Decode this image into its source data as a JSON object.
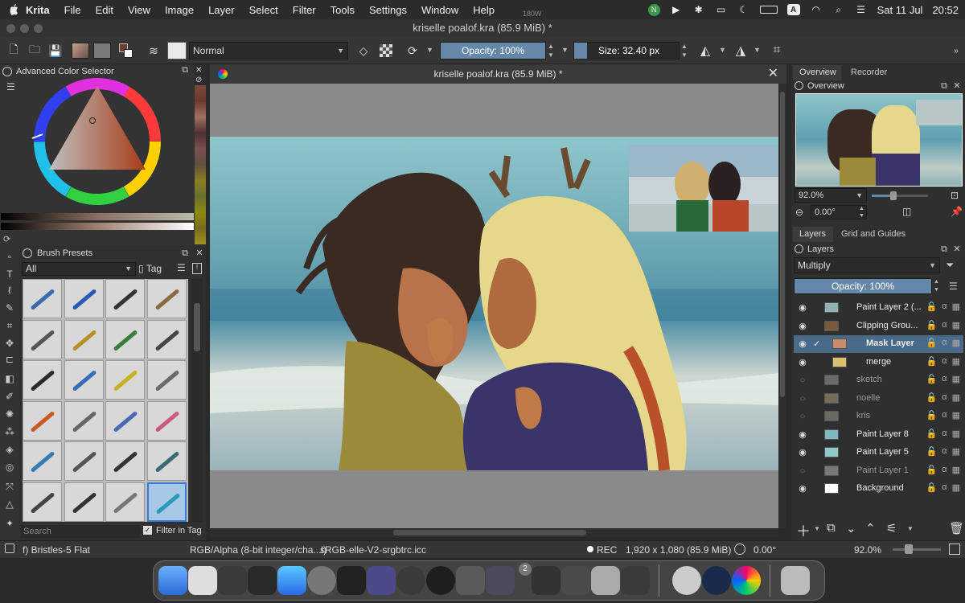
{
  "menubar": {
    "app": "Krita",
    "items": [
      "File",
      "Edit",
      "View",
      "Image",
      "Layer",
      "Select",
      "Filter",
      "Tools",
      "Settings",
      "Window",
      "Help"
    ],
    "center_badge": "180W",
    "date": "Sat 11 Jul",
    "time": "20:52",
    "input_indicator": "A"
  },
  "window": {
    "title": "kriselle poalof.kra (85.9 MiB) *"
  },
  "toolbar": {
    "blend_mode": "Normal",
    "opacity": "Opacity: 100%",
    "opacity_value": 1.0,
    "size": "Size: 32.40 px",
    "size_fill": 0.12
  },
  "color_selector": {
    "title": "Advanced Color Selector"
  },
  "brush_presets": {
    "title": "Brush Presets",
    "filter": "All",
    "tag": "Tag",
    "search_placeholder": "Search",
    "filter_in_tag": "Filter in Tag"
  },
  "document": {
    "tab_title": "kriselle poalof.kra (85.9 MiB) *"
  },
  "overview": {
    "tabs": [
      "Overview",
      "Recorder"
    ],
    "title": "Overview",
    "zoom": "92.0%",
    "rotation": "0.00°"
  },
  "layers": {
    "tabs": [
      "Layers",
      "Grid and Guides"
    ],
    "title": "Layers",
    "blend_mode": "Multiply",
    "opacity": "Opacity:  100%",
    "items": [
      {
        "name": "Paint Layer 2 (...",
        "visible": true,
        "thumb": "#8fb4b8"
      },
      {
        "name": "Clipping Grou...",
        "visible": true,
        "thumb": "#7a5a3a"
      },
      {
        "name": "Mask Layer",
        "visible": true,
        "thumb": "#c88a6a",
        "selected": true,
        "check": "✓"
      },
      {
        "name": "merge",
        "visible": true,
        "thumb": "#d8c070"
      },
      {
        "name": "sketch",
        "visible": false,
        "thumb": "#6a6a6a"
      },
      {
        "name": "noelle",
        "visible": false,
        "thumb": "#7a6a5a"
      },
      {
        "name": "kris",
        "visible": false,
        "thumb": "#6a6a60"
      },
      {
        "name": "Paint Layer 8",
        "visible": true,
        "thumb": "#7fb8c0"
      },
      {
        "name": "Paint Layer 5",
        "visible": true,
        "thumb": "#8fc8c8"
      },
      {
        "name": "Paint Layer 1",
        "visible": false,
        "thumb": "#777"
      },
      {
        "name": "Background",
        "visible": true,
        "thumb": "#ffffff"
      }
    ]
  },
  "status": {
    "brush": "f) Bristles-5 Flat",
    "colorspace": "RGB/Alpha (8-bit integer/cha...l)",
    "profile": "sRGB-elle-V2-srgbtrc.icc",
    "rec": "REC",
    "dims": "1,920 x 1,080 (85.9 MiB)",
    "rotation": "0.00°",
    "zoom": "92.0%"
  },
  "dock": {
    "badge": "2"
  }
}
